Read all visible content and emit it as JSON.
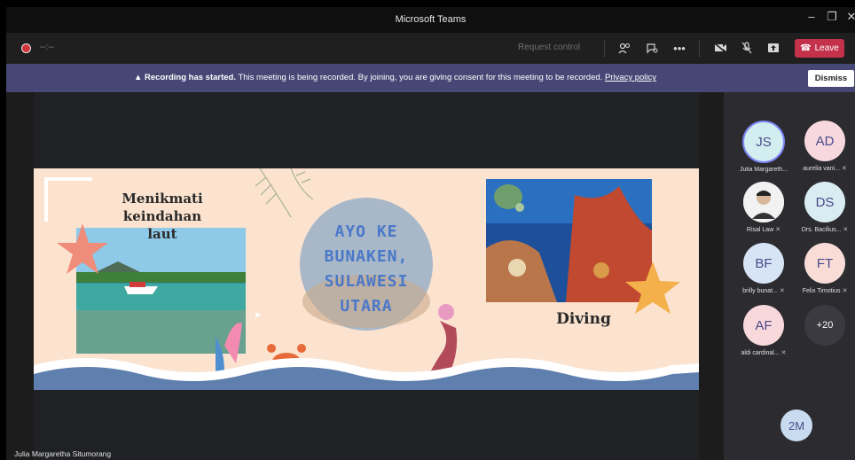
{
  "window": {
    "title": "Microsoft Teams"
  },
  "toolbar": {
    "timer": "--:--",
    "request_control": "Request control",
    "leave_label": "Leave"
  },
  "banner": {
    "heading": "Recording has started.",
    "text": "This meeting is being recorded. By joining, you are giving consent for this meeting to be recorded.",
    "link": "Privacy policy",
    "dismiss_label": "Dismiss"
  },
  "slide": {
    "left_heading_line1": "Menikmati keindahan",
    "left_heading_line2": "laut",
    "circle_line1": "AYO KE",
    "circle_line2": "BUNAKEN,",
    "circle_line3": "SULAWESI",
    "circle_line4": "UTARA",
    "right_caption": "Diving"
  },
  "presenter_name": "Julia Margaretha Situmorang",
  "participants": [
    {
      "initials": "JS",
      "name": "Julia Margareth...",
      "color": "#d3eef0"
    },
    {
      "initials": "AD",
      "name": "aurelia vani...",
      "color": "#f8d8df"
    },
    {
      "initials": "",
      "name": "Risal Law",
      "color": "#ffffff"
    },
    {
      "initials": "DS",
      "name": "Drs. Bacilius...",
      "color": "#d9ecf2"
    },
    {
      "initials": "BF",
      "name": "brilly bunat...",
      "color": "#d6e4f5"
    },
    {
      "initials": "FT",
      "name": "Felix Timotius",
      "color": "#f9dcd6"
    },
    {
      "initials": "AF",
      "name": "aldi cardinal...",
      "color": "#f9d8dc"
    }
  ],
  "overflow": {
    "label": "+20"
  },
  "self_tile": {
    "initials": "2M"
  }
}
